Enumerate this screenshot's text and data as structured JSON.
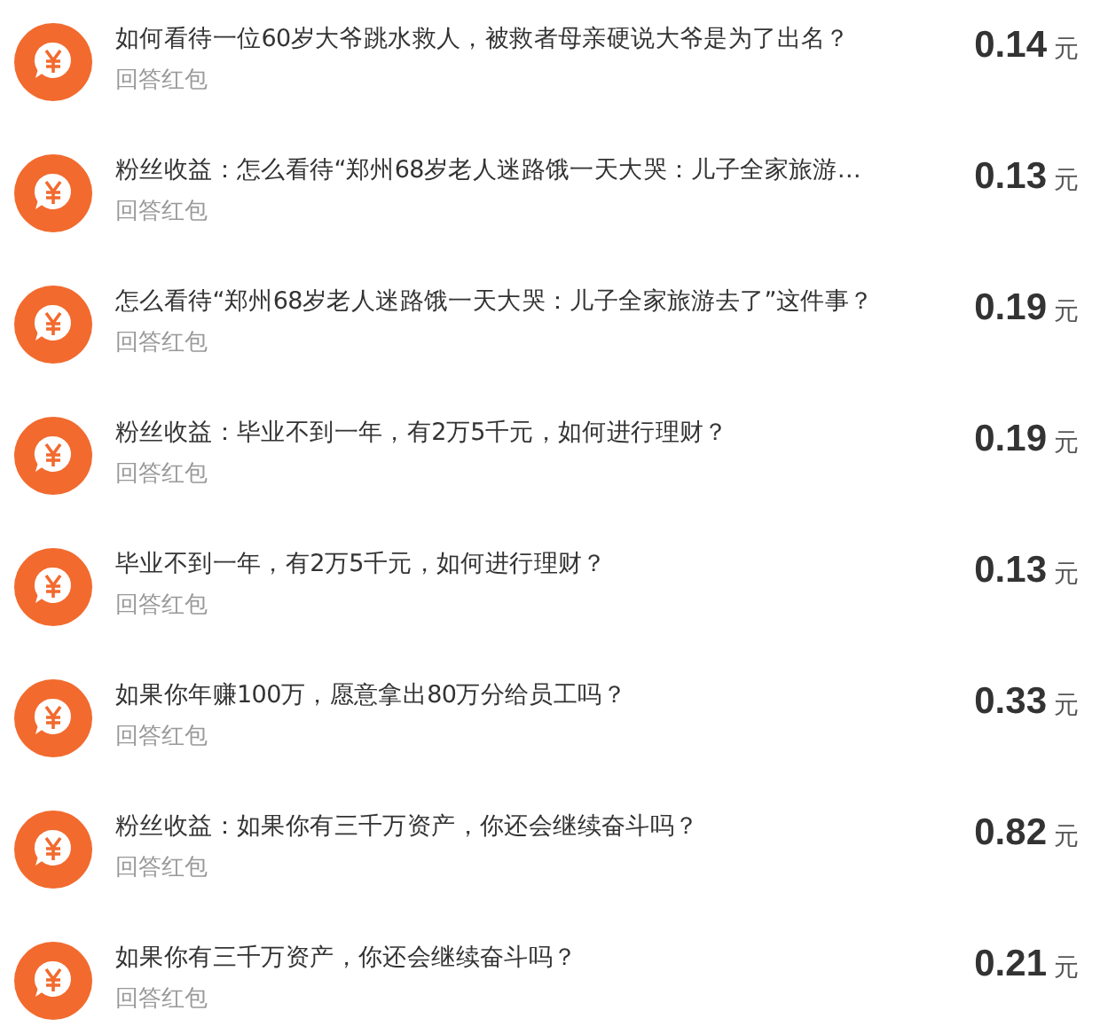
{
  "items": [
    {
      "title": "如何看待一位60岁大爷跳水救人，被救者母亲硬说大爷是为了出名？",
      "subtitle": "回答红包",
      "amount": "0.14",
      "unit": "元"
    },
    {
      "title": "粉丝收益：怎么看待“郑州68岁老人迷路饿一天大哭：儿子全家旅游…",
      "subtitle": "回答红包",
      "amount": "0.13",
      "unit": "元"
    },
    {
      "title": "怎么看待“郑州68岁老人迷路饿一天大哭：儿子全家旅游去了”这件事？",
      "subtitle": "回答红包",
      "amount": "0.19",
      "unit": "元"
    },
    {
      "title": "粉丝收益：毕业不到一年，有2万5千元，如何进行理财？",
      "subtitle": "回答红包",
      "amount": "0.19",
      "unit": "元"
    },
    {
      "title": "毕业不到一年，有2万5千元，如何进行理财？",
      "subtitle": "回答红包",
      "amount": "0.13",
      "unit": "元"
    },
    {
      "title": "如果你年赚100万，愿意拿出80万分给员工吗？",
      "subtitle": "回答红包",
      "amount": "0.33",
      "unit": "元"
    },
    {
      "title": "粉丝收益：如果你有三千万资产，你还会继续奋斗吗？",
      "subtitle": "回答红包",
      "amount": "0.82",
      "unit": "元"
    },
    {
      "title": "如果你有三千万资产，你还会继续奋斗吗？",
      "subtitle": "回答红包",
      "amount": "0.21",
      "unit": "元"
    }
  ]
}
